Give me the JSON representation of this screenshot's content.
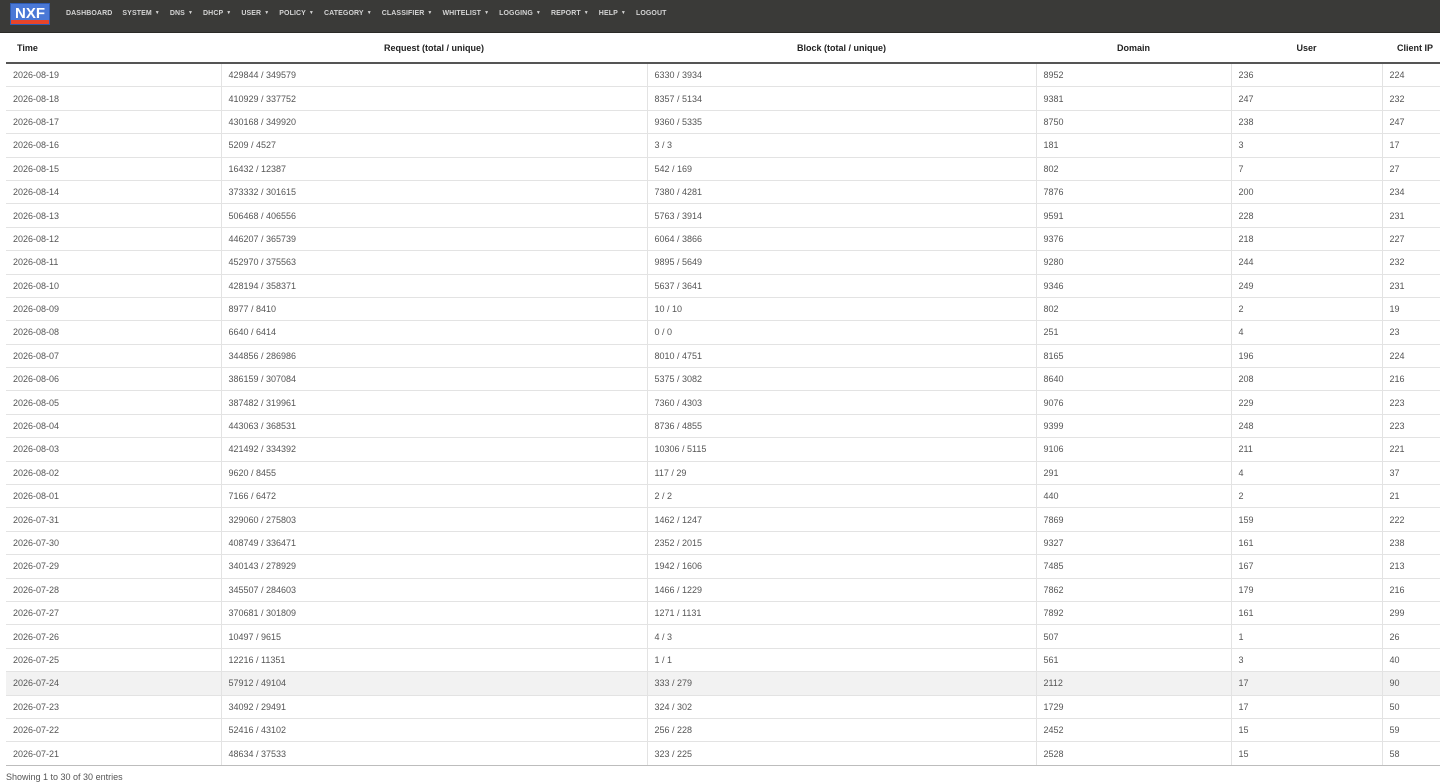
{
  "brand": {
    "logo_text": "NXF",
    "colors": {
      "navbar_bg": "#3a3a38",
      "logo_bg": "#4a78d6",
      "logo_stripe": "#e8452a"
    }
  },
  "nav": {
    "items": [
      {
        "label": "DASHBOARD",
        "has_dropdown": false
      },
      {
        "label": "SYSTEM",
        "has_dropdown": true
      },
      {
        "label": "DNS",
        "has_dropdown": true
      },
      {
        "label": "DHCP",
        "has_dropdown": true
      },
      {
        "label": "USER",
        "has_dropdown": true
      },
      {
        "label": "POLICY",
        "has_dropdown": true
      },
      {
        "label": "CATEGORY",
        "has_dropdown": true
      },
      {
        "label": "CLASSIFIER",
        "has_dropdown": true
      },
      {
        "label": "WHITELIST",
        "has_dropdown": true
      },
      {
        "label": "LOGGING",
        "has_dropdown": true
      },
      {
        "label": "REPORT",
        "has_dropdown": true
      },
      {
        "label": "HELP",
        "has_dropdown": true
      },
      {
        "label": "LOGOUT",
        "has_dropdown": false
      }
    ],
    "dropdown_glyph": "▼"
  },
  "table": {
    "columns": [
      "Time",
      "Request (total / unique)",
      "Block (total / unique)",
      "Domain",
      "User",
      "Client IP"
    ],
    "highlighted_row": 26,
    "rows": [
      [
        "2026-08-19",
        "429844 / 349579",
        "6330 / 3934",
        "8952",
        "236",
        "224"
      ],
      [
        "2026-08-18",
        "410929 / 337752",
        "8357 / 5134",
        "9381",
        "247",
        "232"
      ],
      [
        "2026-08-17",
        "430168 / 349920",
        "9360 / 5335",
        "8750",
        "238",
        "247"
      ],
      [
        "2026-08-16",
        "5209 / 4527",
        "3 / 3",
        "181",
        "3",
        "17"
      ],
      [
        "2026-08-15",
        "16432 / 12387",
        "542 / 169",
        "802",
        "7",
        "27"
      ],
      [
        "2026-08-14",
        "373332 / 301615",
        "7380 / 4281",
        "7876",
        "200",
        "234"
      ],
      [
        "2026-08-13",
        "506468 / 406556",
        "5763 / 3914",
        "9591",
        "228",
        "231"
      ],
      [
        "2026-08-12",
        "446207 / 365739",
        "6064 / 3866",
        "9376",
        "218",
        "227"
      ],
      [
        "2026-08-11",
        "452970 / 375563",
        "9895 / 5649",
        "9280",
        "244",
        "232"
      ],
      [
        "2026-08-10",
        "428194 / 358371",
        "5637 / 3641",
        "9346",
        "249",
        "231"
      ],
      [
        "2026-08-09",
        "8977 / 8410",
        "10 / 10",
        "802",
        "2",
        "19"
      ],
      [
        "2026-08-08",
        "6640 / 6414",
        "0 / 0",
        "251",
        "4",
        "23"
      ],
      [
        "2026-08-07",
        "344856 / 286986",
        "8010 / 4751",
        "8165",
        "196",
        "224"
      ],
      [
        "2026-08-06",
        "386159 / 307084",
        "5375 / 3082",
        "8640",
        "208",
        "216"
      ],
      [
        "2026-08-05",
        "387482 / 319961",
        "7360 / 4303",
        "9076",
        "229",
        "223"
      ],
      [
        "2026-08-04",
        "443063 / 368531",
        "8736 / 4855",
        "9399",
        "248",
        "223"
      ],
      [
        "2026-08-03",
        "421492 / 334392",
        "10306 / 5115",
        "9106",
        "211",
        "221"
      ],
      [
        "2026-08-02",
        "9620 / 8455",
        "117 / 29",
        "291",
        "4",
        "37"
      ],
      [
        "2026-08-01",
        "7166 / 6472",
        "2 / 2",
        "440",
        "2",
        "21"
      ],
      [
        "2026-07-31",
        "329060 / 275803",
        "1462 / 1247",
        "7869",
        "159",
        "222"
      ],
      [
        "2026-07-30",
        "408749 / 336471",
        "2352 / 2015",
        "9327",
        "161",
        "238"
      ],
      [
        "2026-07-29",
        "340143 / 278929",
        "1942 / 1606",
        "7485",
        "167",
        "213"
      ],
      [
        "2026-07-28",
        "345507 / 284603",
        "1466 / 1229",
        "7862",
        "179",
        "216"
      ],
      [
        "2026-07-27",
        "370681 / 301809",
        "1271 / 1131",
        "7892",
        "161",
        "299"
      ],
      [
        "2026-07-26",
        "10497 / 9615",
        "4 / 3",
        "507",
        "1",
        "26"
      ],
      [
        "2026-07-25",
        "12216 / 11351",
        "1 / 1",
        "561",
        "3",
        "40"
      ],
      [
        "2026-07-24",
        "57912 / 49104",
        "333 / 279",
        "2112",
        "17",
        "90"
      ],
      [
        "2026-07-23",
        "34092 / 29491",
        "324 / 302",
        "1729",
        "17",
        "50"
      ],
      [
        "2026-07-22",
        "52416 / 43102",
        "256 / 228",
        "2452",
        "15",
        "59"
      ],
      [
        "2026-07-21",
        "48634 / 37533",
        "323 / 225",
        "2528",
        "15",
        "58"
      ]
    ]
  },
  "footer": {
    "info": "Showing 1 to 30 of 30 entries"
  }
}
